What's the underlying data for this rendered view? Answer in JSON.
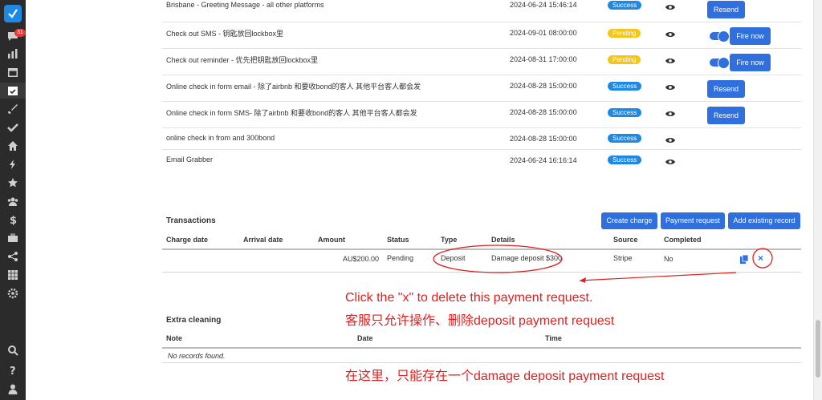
{
  "sidebar": {
    "notification_count": "31",
    "icons": [
      "chat-icon",
      "chart-icon",
      "calendar-icon",
      "task-icon",
      "brush-icon",
      "check-icon",
      "home-icon",
      "bolt-icon",
      "star-icon",
      "users-icon",
      "dollar-icon",
      "briefcase-icon",
      "share-icon",
      "grid-icon",
      "gear-icon",
      "search-icon",
      "help-icon",
      "user-icon"
    ]
  },
  "messages": [
    {
      "name": "Brisbane - Greeting Message - all other platforms",
      "time": "2024-06-24 15:46:14",
      "status": "Success",
      "action": "Resend"
    },
    {
      "name": "Check out SMS - 钥匙放回lockbox里",
      "time": "2024-09-01 08:00:00",
      "status": "Pending",
      "action": "Fire now"
    },
    {
      "name": "Check out reminder - 优先把钥匙放回lockbox里",
      "time": "2024-08-31 17:00:00",
      "status": "Pending",
      "action": "Fire now"
    },
    {
      "name": "Online check in form email - 除了airbnb 和要收bond的客人 其他平台客人都会发",
      "time": "2024-08-28 15:00:00",
      "status": "Success",
      "action": "Resend"
    },
    {
      "name": "Online check in form SMS- 除了airbnb 和要收bond的客人 其他平台客人都会发",
      "time": "2024-08-28 15:00:00",
      "status": "Success",
      "action": "Resend"
    },
    {
      "name": "online check in from and 300bond",
      "time": "2024-08-28 15:00:00",
      "status": "Success",
      "action": ""
    },
    {
      "name": "Email Grabber",
      "time": "2024-06-24 16:16:14",
      "status": "Success",
      "action": ""
    }
  ],
  "transactions": {
    "title": "Transactions",
    "buttons": {
      "create": "Create charge",
      "payment": "Payment request",
      "existing": "Add existing record"
    },
    "headers": [
      "Charge date",
      "Arrival date",
      "Amount",
      "Status",
      "Type",
      "Details",
      "Source",
      "Completed"
    ],
    "row": {
      "charge_date": "",
      "arrival_date": "",
      "amount": "AU$200.00",
      "status": "Pending",
      "type": "Deposit",
      "details": "Damage deposit $300",
      "source": "Stripe",
      "completed": "No",
      "delete": "×"
    }
  },
  "extra_cleaning": {
    "title": "Extra cleaning",
    "headers": [
      "Note",
      "Date",
      "Time"
    ],
    "empty": "No records found."
  },
  "annotations": {
    "line1": "Click the \"x\" to delete this payment request.",
    "line2": "客服只允许操作、删除deposit payment request",
    "line3": "在这里，只能存在一个damage deposit payment request"
  },
  "colors": {
    "accent": "#2f6fde",
    "success": "#1e88e5",
    "pending": "#f5c518",
    "annotation": "#e02020",
    "sidebar": "#2b2b2b"
  }
}
